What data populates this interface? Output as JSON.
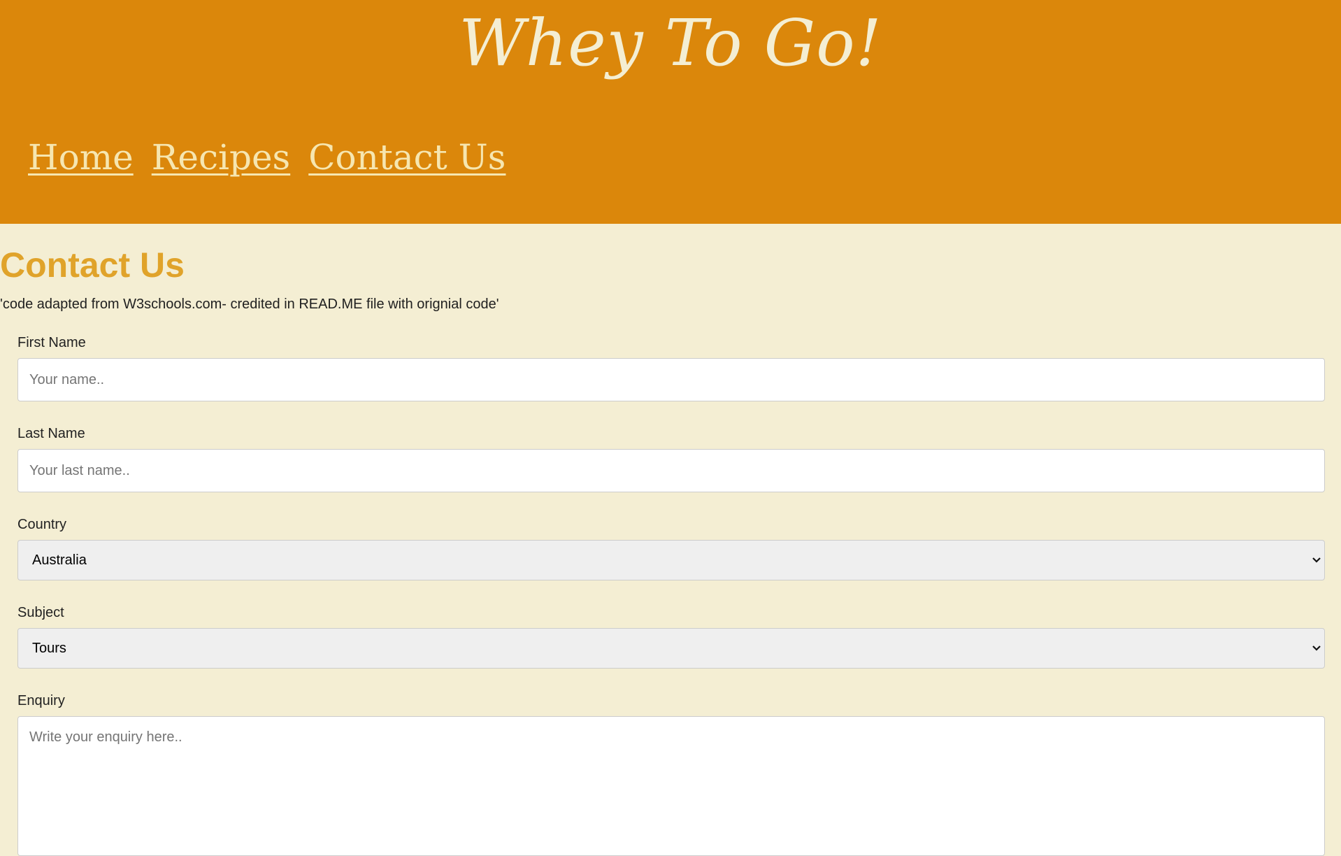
{
  "header": {
    "site_title": "Whey To Go!",
    "background_color": "#db870b",
    "nav": [
      {
        "label": "Home"
      },
      {
        "label": "Recipes"
      },
      {
        "label": "Contact Us"
      }
    ]
  },
  "main": {
    "heading": "Contact Us",
    "credit_note": "'code adapted from W3schools.com- credited in READ.ME file with orignial code'",
    "form": {
      "first_name": {
        "label": "First Name",
        "placeholder": "Your name.."
      },
      "last_name": {
        "label": "Last Name",
        "placeholder": "Your last name.."
      },
      "country": {
        "label": "Country",
        "selected": "Australia",
        "icon": "chevron-down-icon"
      },
      "subject": {
        "label": "Subject",
        "selected": "Tours",
        "icon": "chevron-down-icon"
      },
      "enquiry": {
        "label": "Enquiry",
        "placeholder": "Write your enquiry here.."
      }
    }
  },
  "colors": {
    "page_background": "#f4eed3",
    "heading": "#e0a32a",
    "nav_link": "#f6e6b0"
  }
}
